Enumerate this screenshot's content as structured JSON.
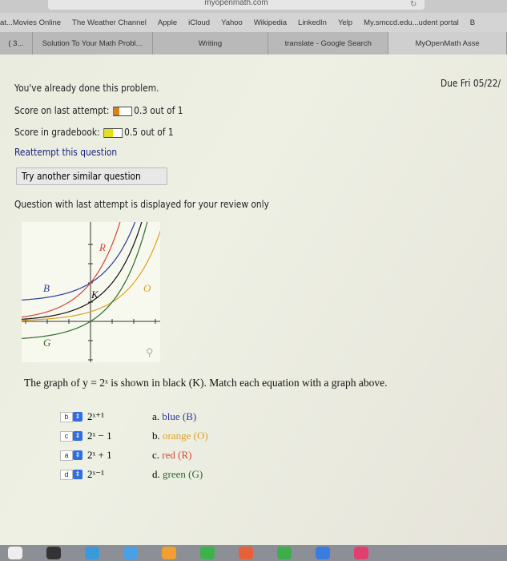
{
  "browser": {
    "url": "myopenmath.com",
    "bookmarks": [
      "at...Movies Online",
      "The Weather Channel",
      "Apple",
      "iCloud",
      "Yahoo",
      "Wikipedia",
      "LinkedIn",
      "Yelp",
      "My.smccd.edu...udent portal",
      "B"
    ],
    "tabs": [
      {
        "label": "( 3...",
        "active": false
      },
      {
        "label": "Solution To Your Math Probl...",
        "active": false
      },
      {
        "label": "Writing",
        "active": false
      },
      {
        "label": "translate - Google Search",
        "active": false
      },
      {
        "label": "MyOpenMath Asse",
        "active": true
      }
    ]
  },
  "page": {
    "due": "Due Fri 05/22/",
    "already_done": "You've already done this problem.",
    "last_attempt_label": "Score on last attempt:",
    "last_attempt_score": "0.3 out of 1",
    "last_attempt_fraction": 0.3,
    "last_attempt_color": "#d9801a",
    "gradebook_label": "Score in gradebook:",
    "gradebook_score": "0.5 out of 1",
    "gradebook_fraction": 0.5,
    "gradebook_color": "#e3e01a",
    "reattempt_link": "Reattempt this question",
    "try_another_button": "Try another similar question",
    "review_note": "Question with last attempt is displayed for your review only"
  },
  "question": {
    "graph_labels": {
      "R": "R",
      "B": "B",
      "K": "K",
      "O": "O",
      "G": "G"
    },
    "curve_colors": {
      "B": "#2a3a9c",
      "R": "#d2453a",
      "K": "#111111",
      "O": "#e0a020",
      "G": "#2c6a2c"
    },
    "prompt": "The graph of y = 2ˣ is shown in black (K). Match each equation with a graph above.",
    "selects": [
      {
        "value": "b",
        "expr": "2ˣ⁺¹"
      },
      {
        "value": "c",
        "expr": "2ˣ − 1"
      },
      {
        "value": "a",
        "expr": "2ˣ + 1"
      },
      {
        "value": "d",
        "expr": "2ˣ⁻¹"
      }
    ],
    "options": [
      {
        "letter": "a.",
        "text": "blue (B)",
        "color": "#2a3a9c"
      },
      {
        "letter": "b.",
        "text": "orange (O)",
        "color": "#e0a020"
      },
      {
        "letter": "c.",
        "text": "red (R)",
        "color": "#d2453a"
      },
      {
        "letter": "d.",
        "text": "green (G)",
        "color": "#2c6a2c"
      }
    ]
  }
}
